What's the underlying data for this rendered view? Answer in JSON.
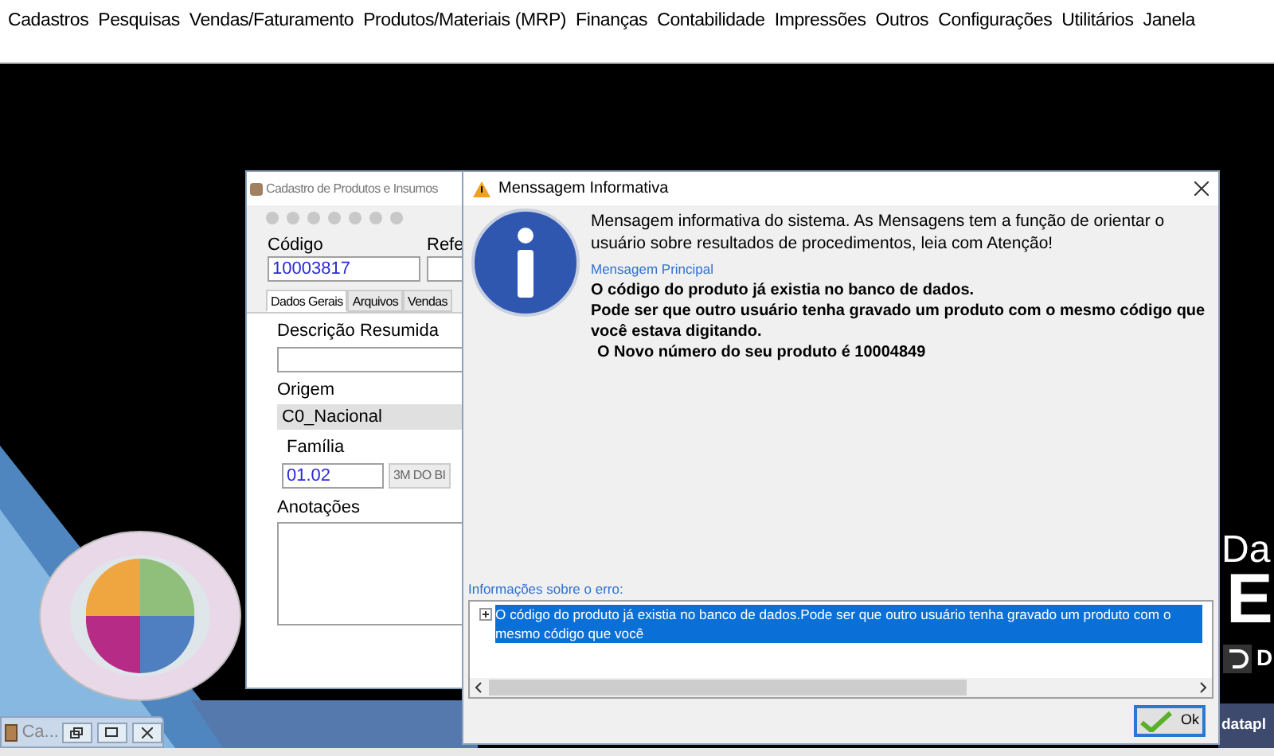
{
  "menu_bar": {
    "items": [
      "Cadastros",
      "Pesquisas",
      "Vendas/Faturamento",
      "Produtos/Materiais (MRP)",
      "Finanças",
      "Contabilidade",
      "Impressões",
      "Outros",
      "Configurações",
      "Utilitários",
      "Janela"
    ]
  },
  "product_window": {
    "title": "Cadastro de Produtos e Insumos",
    "code_label": "Código",
    "code_value": "10003817",
    "ref_label": "Refe",
    "tabs": [
      {
        "label": "Dados Gerais",
        "selected": true
      },
      {
        "label": "Arquivos",
        "selected": false
      },
      {
        "label": "Vendas",
        "selected": false
      }
    ],
    "description_label": "Descrição Resumida",
    "origin_label": "Origem",
    "origin_value": "C0_Nacional",
    "family_label": "Família",
    "family_code": "01.02",
    "family_name": "3M DO BI",
    "notes_label": "Anotações"
  },
  "dialog": {
    "title": "Menssagem Informativa",
    "intro": "Mensagem informativa do sistema. As Mensagens tem a função de orientar o usuário sobre resultados de procedimentos, leia com Atenção!",
    "main_label": "Mensagem Principal",
    "main_lines": [
      "O código do produto já existia no banco de dados.",
      "Pode ser que outro usuário tenha gravado um produto com o mesmo código que você estava digitando.",
      "O Novo número do seu produto é 10004849"
    ],
    "error_label": "Informações sobre o erro:",
    "error_items": [
      {
        "text": "O código do produto já existia no banco de dados.Pode ser que outro usuário tenha gravado um produto com o mesmo código que você",
        "expanded": false,
        "selected": true
      }
    ],
    "ok_button": "Ok"
  },
  "brand": {
    "line_1": "Da",
    "line_2": "E",
    "logo_text": "D",
    "footer": "datapl"
  },
  "minimized_window": {
    "title": "Ca..."
  }
}
